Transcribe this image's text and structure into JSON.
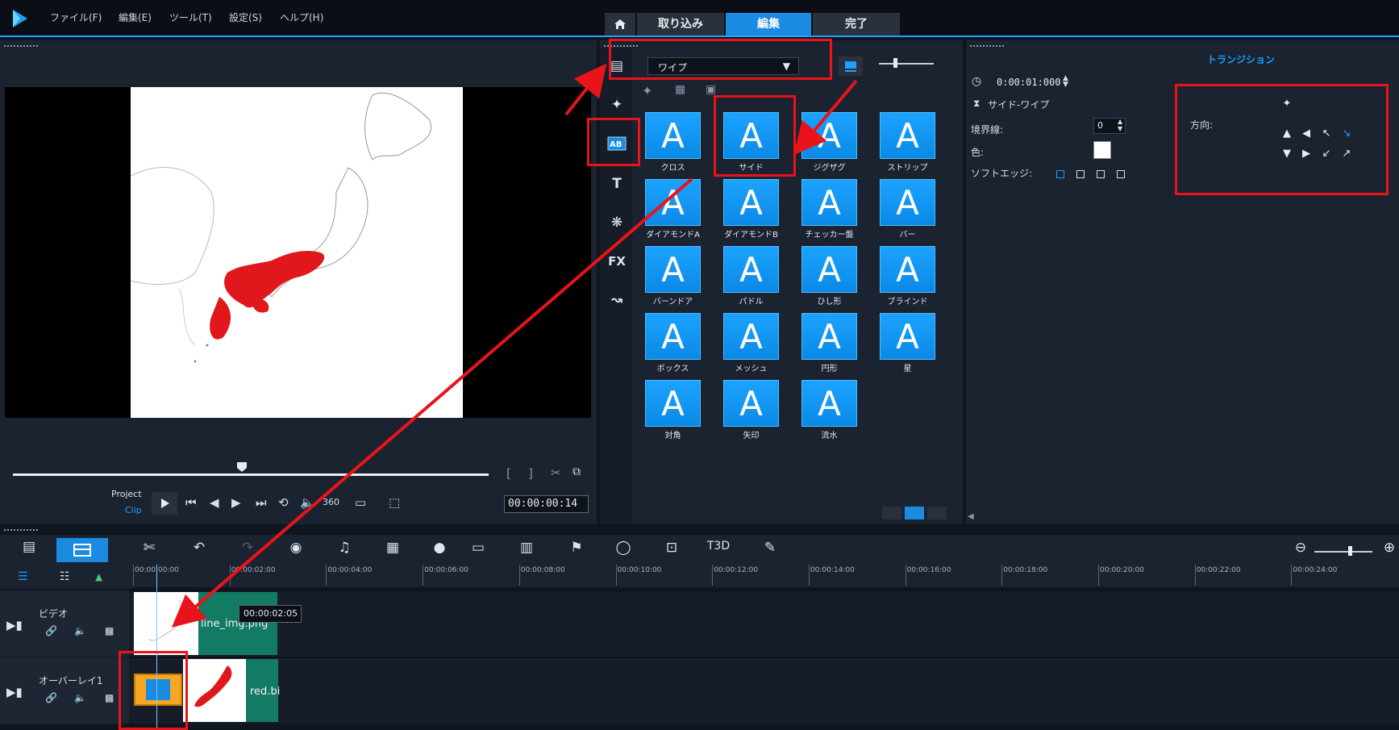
{
  "menu": [
    "ファイル(F)",
    "編集(E)",
    "ツール(T)",
    "設定(S)",
    "ヘルプ(H)"
  ],
  "tabs": {
    "capture": "取り込み",
    "edit": "編集",
    "share": "完了"
  },
  "preview": {
    "mode_project": "Project",
    "mode_clip": "Clip",
    "timecode": "00:00:00:14"
  },
  "library": {
    "category": "ワイプ",
    "transitions": [
      "クロス",
      "サイド",
      "ジグザグ",
      "ストリップ",
      "ダイアモンドA",
      "ダイアモンドB",
      "チェッカー盤",
      "バー",
      "バーンドア",
      "パドル",
      "ひし形",
      "ブラインド",
      "ボックス",
      "メッシュ",
      "円形",
      "星",
      "対角",
      "矢印",
      "流水"
    ],
    "glyph": "A"
  },
  "options": {
    "tab_title": "トランジション",
    "duration": "0:00:01:000",
    "effect_name": "サイド-ワイプ",
    "border_label": "境界線:",
    "border_value": "0",
    "color_label": "色:",
    "soft_edge_label": "ソフトエッジ:",
    "direction_label": "方向:"
  },
  "timeline": {
    "ruler_ticks": [
      "00:00:00:00",
      "00:00:02:00",
      "00:00:04:00",
      "00:00:06:00",
      "00:00:08:00",
      "00:00:10:00",
      "00:00:12:00",
      "00:00:14:00",
      "00:00:16:00",
      "00:00:18:00",
      "00:00:20:00",
      "00:00:22:00",
      "00:00:24:00"
    ],
    "tracks": [
      {
        "name": "ビデオ",
        "clip_label": "line_img.png"
      },
      {
        "name": "オーバーレイ1",
        "clip_label": "red.bi"
      }
    ],
    "tooltip": "00:00:02:05"
  },
  "colors": {
    "accent": "#1ea0ff",
    "clip_green": "#137a63",
    "transition_orange": "#f5a623",
    "annotation_red": "#e8141a"
  }
}
